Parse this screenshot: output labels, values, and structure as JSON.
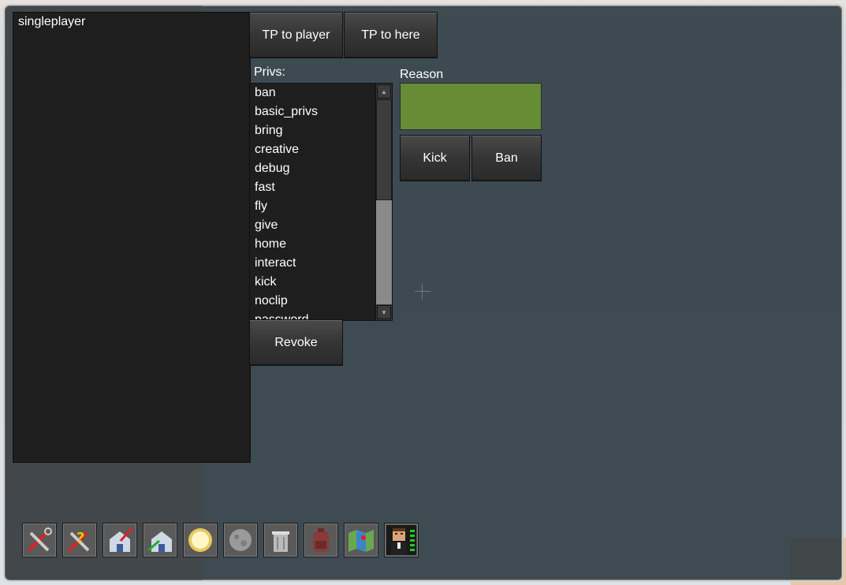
{
  "players": [
    "singleplayer"
  ],
  "buttons": {
    "tp_to_player": "TP to player",
    "tp_to_here": "TP to here",
    "kick": "Kick",
    "ban": "Ban",
    "revoke": "Revoke"
  },
  "privs": {
    "label": "Privs:",
    "items": [
      "ban",
      "basic_privs",
      "bring",
      "creative",
      "debug",
      "fast",
      "fly",
      "give",
      "home",
      "interact",
      "kick",
      "noclip",
      "password"
    ]
  },
  "reason": {
    "label": "Reason",
    "value": ""
  },
  "toolbar": {
    "tools": [
      "wrench-screwdriver-icon",
      "help-tools-icon",
      "home-set-icon",
      "home-go-icon",
      "sun-icon",
      "moon-icon",
      "trash-icon",
      "backpack-icon",
      "map-icon",
      "player-icon"
    ]
  },
  "colors": {
    "reason_field": "#668c36",
    "panel": "#1e1e1e"
  }
}
